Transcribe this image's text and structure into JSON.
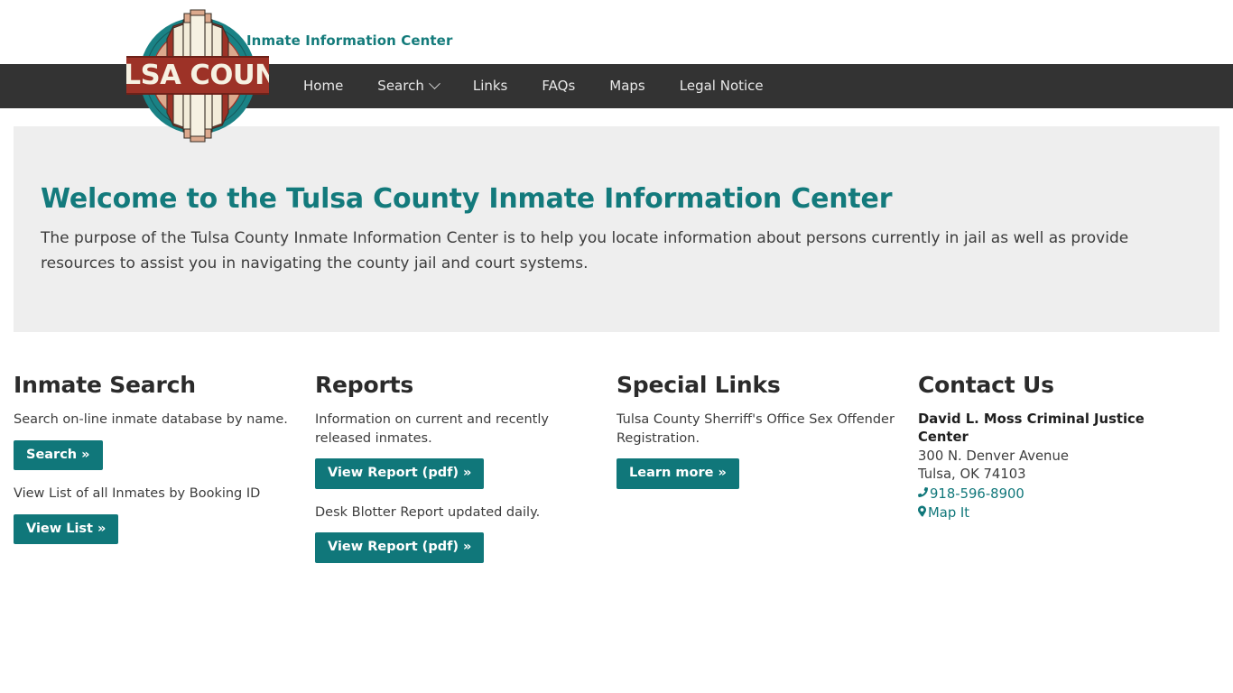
{
  "header": {
    "site_title": "Inmate Information Center",
    "logo_alt": "Tulsa County",
    "logo_banner_text": "TULSA COUNTY"
  },
  "nav": {
    "items": [
      {
        "label": "Home",
        "icon": ""
      },
      {
        "label": "Search",
        "icon": "chevron-down-icon"
      },
      {
        "label": "Links",
        "icon": ""
      },
      {
        "label": "FAQs",
        "icon": ""
      },
      {
        "label": "Maps",
        "icon": ""
      },
      {
        "label": "Legal Notice",
        "icon": ""
      }
    ]
  },
  "hero": {
    "heading": "Welcome to the Tulsa County Inmate Information Center",
    "body": "The purpose of the Tulsa County Inmate Information Center is to help you locate information about persons currently in jail as well as provide resources to assist you in navigating the county jail and court systems."
  },
  "columns": {
    "inmate_search": {
      "heading": "Inmate Search",
      "desc_1": "Search on-line inmate database by name.",
      "button_1": "Search »",
      "desc_2": "View List of all Inmates by Booking ID",
      "button_2": "View List »"
    },
    "reports": {
      "heading": "Reports",
      "desc_1": "Information on current and recently released inmates.",
      "button_1": "View Report (pdf) »",
      "desc_2": "Desk Blotter Report updated daily.",
      "button_2": "View Report (pdf) »"
    },
    "special_links": {
      "heading": "Special Links",
      "desc_1": "Tulsa County Sherriff's Office Sex Offender Registration.",
      "button_1": "Learn more »"
    },
    "contact_us": {
      "heading": "Contact Us",
      "facility": "David L. Moss Criminal Justice Center",
      "street": "300 N. Denver Avenue",
      "city_state_zip": "Tulsa, OK 74103",
      "phone": "918-596-8900",
      "phone_icon": "phone-icon",
      "map_link": "Map It",
      "map_icon": "map-marker-icon"
    }
  },
  "colors": {
    "teal": "#10777a",
    "teal_heading": "#137a7c",
    "navbar": "#333333",
    "hero_bg": "#eeeeee",
    "logo_red": "#9d3227",
    "logo_teal": "#1a8285",
    "logo_tan": "#d9a98f",
    "logo_cream": "#f3ecd9"
  }
}
